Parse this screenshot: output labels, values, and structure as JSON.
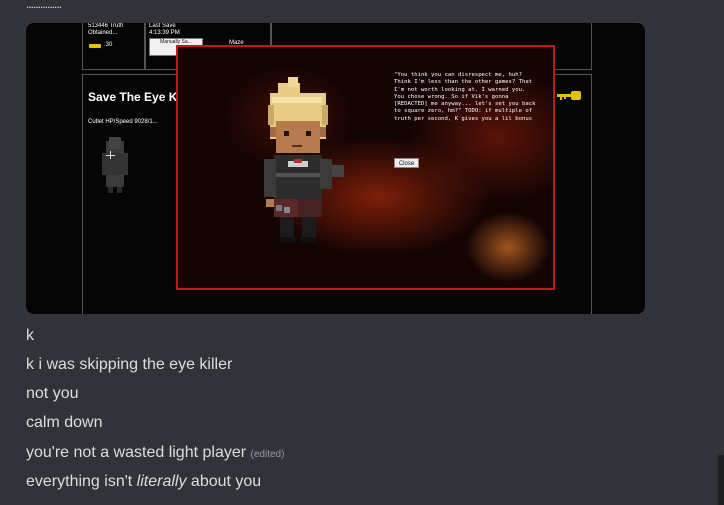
{
  "top_dots": "...............",
  "embed": {
    "truth_stat": "513446 Truth Obtained...",
    "key_count": ":30",
    "last_save": "Last Save 4:13:39 PM",
    "save_button": "Manually Sa...",
    "maze_label": "Maze",
    "game_title": "Save The Eye K",
    "hp_line": "Cutlet HP/Speed 9028/1...",
    "modal": {
      "quote": "\"You think you can disrespect me, huh? Think I'm less than the other games? That I'm not worth looking at. I warned you. You chose wrong. So if Vik's gonna [REDACTED] me anyway... let's set you back to square zero, hm?\" TODO: if multiple of truth per second, K gives you a lil bonus",
      "close_label": "Close"
    }
  },
  "messages": [
    {
      "text": "k"
    },
    {
      "text": "k i was skipping the eye killer"
    },
    {
      "text": "not you"
    },
    {
      "text": "calm down"
    },
    {
      "text": "you're not a wasted light player",
      "edited": "(edited)"
    },
    {
      "pre": "everything isn't ",
      "em": "literally",
      "post": " about you"
    }
  ],
  "colors": {
    "background": "#313338",
    "text": "#dbdee1",
    "muted": "#949ba4",
    "modal_border": "#c01818",
    "key_gold": "#e6c000"
  }
}
